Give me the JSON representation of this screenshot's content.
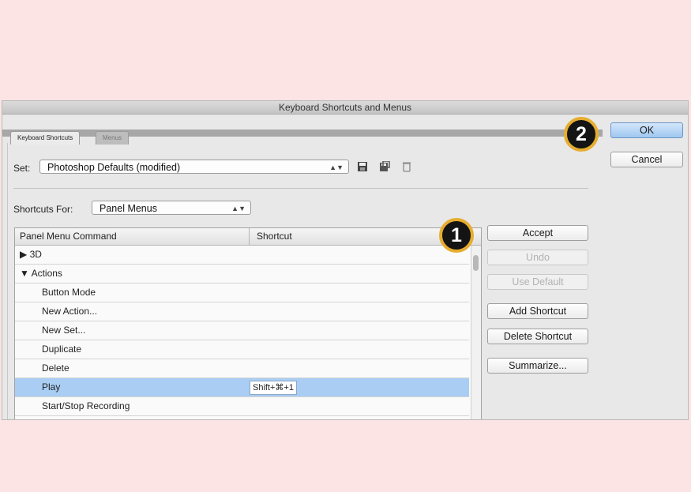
{
  "window": {
    "title": "Keyboard Shortcuts and Menus"
  },
  "tabs": [
    {
      "label": "Keyboard Shortcuts",
      "active": true
    },
    {
      "label": "Menus",
      "active": false
    }
  ],
  "set": {
    "label": "Set:",
    "value": "Photoshop Defaults (modified)"
  },
  "set_icons": [
    "save-set-icon",
    "save-as-set-icon",
    "delete-set-icon"
  ],
  "shortcuts_for": {
    "label": "Shortcuts For:",
    "value": "Panel Menus"
  },
  "table": {
    "columns": [
      "Panel Menu Command",
      "Shortcut"
    ],
    "rows": [
      {
        "label": "3D",
        "kind": "group",
        "expanded": false,
        "prefix": "▶ "
      },
      {
        "label": "Actions",
        "kind": "group",
        "expanded": true,
        "prefix": "▼ "
      },
      {
        "label": "Button Mode",
        "kind": "item"
      },
      {
        "label": "New Action...",
        "kind": "item"
      },
      {
        "label": "New Set...",
        "kind": "item"
      },
      {
        "label": "Duplicate",
        "kind": "item"
      },
      {
        "label": "Delete",
        "kind": "item"
      },
      {
        "label": "Play",
        "kind": "item",
        "selected": true,
        "shortcut": "Shift+⌘+1"
      },
      {
        "label": "Start/Stop Recording",
        "kind": "item"
      }
    ]
  },
  "buttons": {
    "accept": "Accept",
    "undo": "Undo",
    "use_default": "Use Default",
    "add_shortcut": "Add Shortcut",
    "delete_shortcut": "Delete Shortcut",
    "summarize": "Summarize...",
    "ok": "OK",
    "cancel": "Cancel"
  },
  "callouts": [
    "1",
    "2"
  ],
  "colors": {
    "background": "#fce4e4",
    "selected_row": "#a9cdf3",
    "callout_ring": "#e6ad2f"
  }
}
